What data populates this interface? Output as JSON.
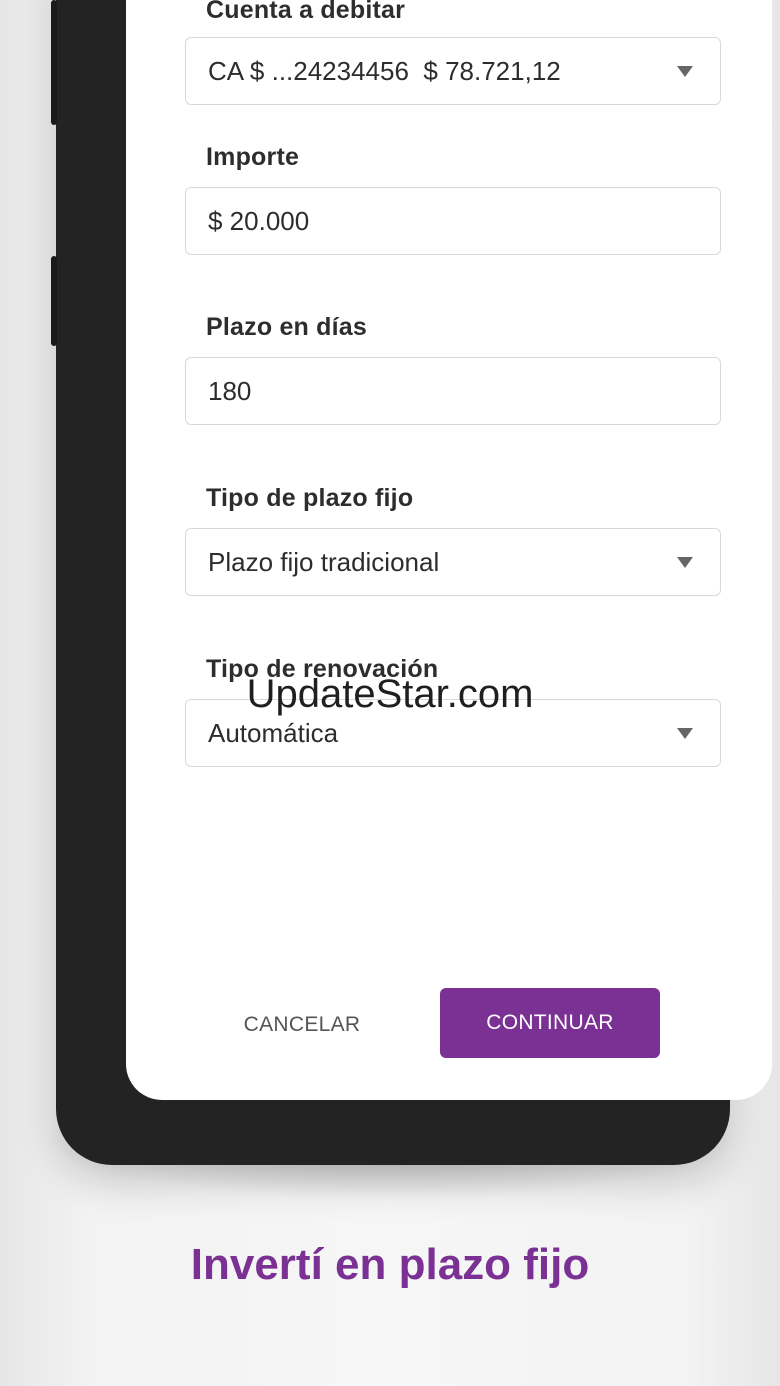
{
  "form": {
    "cuenta": {
      "label": "Cuenta a debitar",
      "value": "CA $ ...24234456  $ 78.721,12"
    },
    "importe": {
      "label": "Importe",
      "value": "$ 20.000"
    },
    "plazo": {
      "label": "Plazo en días",
      "value": "180"
    },
    "tipo_plazo": {
      "label": "Tipo de plazo fijo",
      "value": "Plazo fijo tradicional"
    },
    "renovacion": {
      "label": "Tipo de renovación",
      "value": "Automática"
    }
  },
  "actions": {
    "cancel_label": "CANCELAR",
    "continue_label": "CONTINUAR"
  },
  "watermark": "UpdateStar.com",
  "tagline": "Invertí en plazo fijo",
  "colors": {
    "accent": "#7b3094",
    "text": "#2d2d2d",
    "border": "#d9d9d9"
  },
  "icons": {
    "dropdown": "chevron-down-icon"
  }
}
